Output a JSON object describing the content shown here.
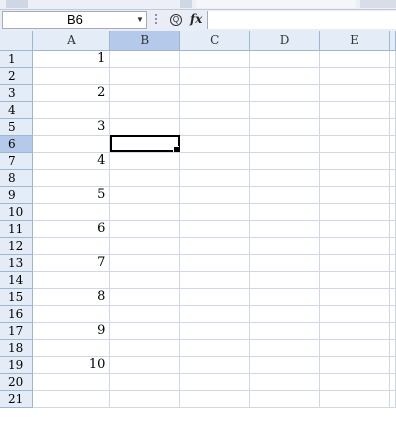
{
  "formula_bar": {
    "name_box_value": "B6",
    "fx_label": "fx",
    "zoom_symbol": "Q",
    "formula_value": ""
  },
  "columns": [
    "A",
    "B",
    "C",
    "D",
    "E"
  ],
  "selected_column": "B",
  "rows": [
    {
      "row": "1",
      "A": "1"
    },
    {
      "row": "2",
      "A": ""
    },
    {
      "row": "3",
      "A": "2"
    },
    {
      "row": "4",
      "A": ""
    },
    {
      "row": "5",
      "A": "3"
    },
    {
      "row": "6",
      "A": ""
    },
    {
      "row": "7",
      "A": "4"
    },
    {
      "row": "8",
      "A": ""
    },
    {
      "row": "9",
      "A": "5"
    },
    {
      "row": "10",
      "A": ""
    },
    {
      "row": "11",
      "A": "6"
    },
    {
      "row": "12",
      "A": ""
    },
    {
      "row": "13",
      "A": "7"
    },
    {
      "row": "14",
      "A": ""
    },
    {
      "row": "15",
      "A": "8"
    },
    {
      "row": "16",
      "A": ""
    },
    {
      "row": "17",
      "A": "9"
    },
    {
      "row": "18",
      "A": ""
    },
    {
      "row": "19",
      "A": "10"
    },
    {
      "row": "20",
      "A": ""
    },
    {
      "row": "21",
      "A": ""
    }
  ],
  "selected_row": "6",
  "active_cell": "B6",
  "colors": {
    "header_bg": "#e4ecf7",
    "header_selected_bg": "#b5c9ea",
    "gridline": "#d0d7e5"
  }
}
